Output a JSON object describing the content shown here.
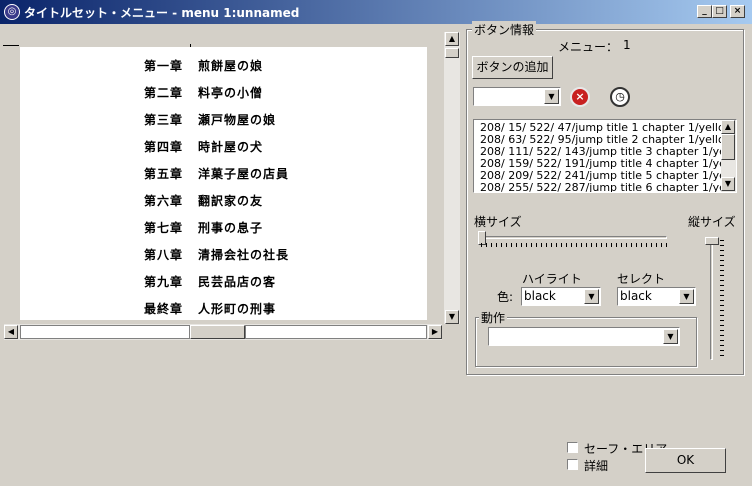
{
  "window": {
    "title": "タイトルセット・メニュー - menu 1:unnamed",
    "minimize": "_",
    "maximize": "□",
    "close": "×"
  },
  "canvas": {
    "chapters": [
      {
        "num": "第一章",
        "title": "煎餅屋の娘"
      },
      {
        "num": "第二章",
        "title": "料亭の小僧"
      },
      {
        "num": "第三章",
        "title": "瀬戸物屋の娘"
      },
      {
        "num": "第四章",
        "title": "時計屋の犬"
      },
      {
        "num": "第五章",
        "title": "洋菓子屋の店員"
      },
      {
        "num": "第六章",
        "title": "翻訳家の友"
      },
      {
        "num": "第七章",
        "title": "刑事の息子"
      },
      {
        "num": "第八章",
        "title": "清掃会社の社長"
      },
      {
        "num": "第九章",
        "title": "民芸品店の客"
      },
      {
        "num": "最終章",
        "title": "人形町の刑事"
      }
    ]
  },
  "panel": {
    "group_label": "ボタン情報",
    "menu_label": "メニュー：",
    "menu_value": "1",
    "add_button": "ボタンの追加",
    "button_list": [
      "208/ 15/ 522/ 47/jump title 1 chapter  1/yello",
      "208/ 63/ 522/ 95/jump title 2 chapter  1/yello",
      "208/ 111/ 522/ 143/jump title 3 chapter  1/ye",
      "208/ 159/ 522/ 191/jump title 4 chapter  1/ye",
      "208/ 209/ 522/ 241/jump title 5 chapter  1/ye",
      "208/ 255/ 522/ 287/jump title 6 chapter  1/ye"
    ],
    "width_label": "横サイズ",
    "height_label": "縦サイズ",
    "color_label": "色:",
    "highlight_label": "ハイライト",
    "highlight_value": "black",
    "select_label": "セレクト",
    "select_value": "black",
    "action_label": "動作",
    "action_value": ""
  },
  "footer": {
    "safe_area_label": "セーフ・エリア",
    "detail_label": "詳細",
    "ok_label": "OK"
  }
}
